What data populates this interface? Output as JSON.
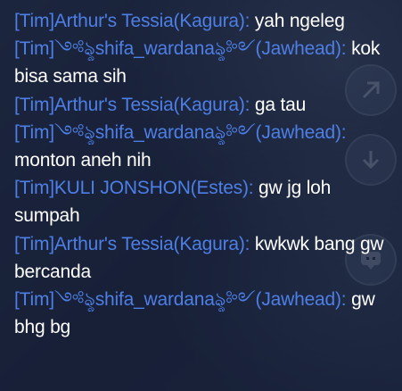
{
  "chat": {
    "messages": [
      {
        "sender": "[Tim]Arthur's Tessia(Kagura):",
        "text": " yah ngeleg"
      },
      {
        "sender": "[Tim]༺ৡshifa_wardanaৡ༻(Jawhead):",
        "text": " kok bisa sama sih"
      },
      {
        "sender": "[Tim]Arthur's Tessia(Kagura):",
        "text": " ga tau"
      },
      {
        "sender": "[Tim]༺ৡshifa_wardanaৡ༻(Jawhead):",
        "text": " monton aneh nih"
      },
      {
        "sender": "[Tim]KULI JONSHON(Estes):",
        "text": " gw jg loh sumpah"
      },
      {
        "sender": "[Tim]Arthur's Tessia(Kagura):",
        "text": " kwkwk bang gw bercanda"
      },
      {
        "sender": "[Tim]༺ৡshifa_wardanaৡ༻(Jawhead):",
        "text": " gw bhg bg"
      }
    ]
  },
  "colors": {
    "sender": "#4d7fe6",
    "message": "#ffffff"
  },
  "icons": [
    "flag-icon",
    "arrow-down-icon",
    "chat-bubble-icon"
  ]
}
